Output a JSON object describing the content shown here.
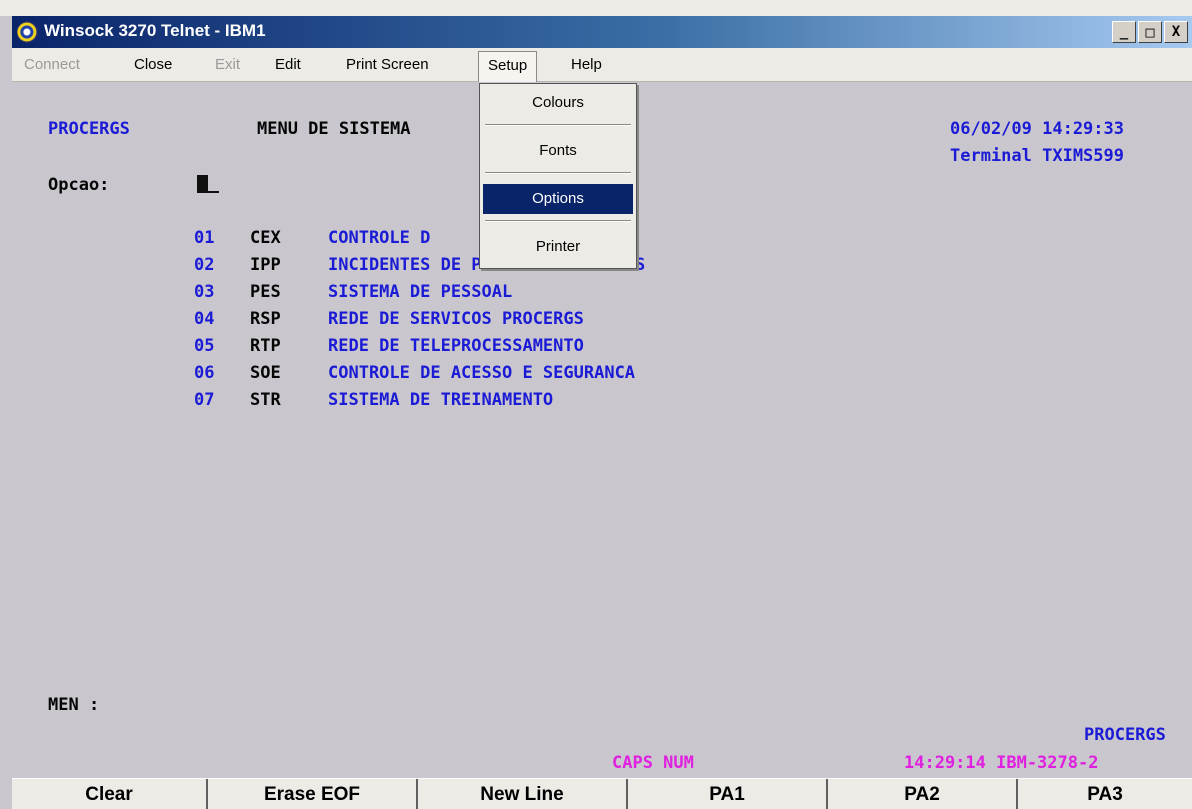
{
  "window": {
    "title": "Winsock 3270 Telnet - IBM1",
    "controls": {
      "minimize": "_",
      "maximize": "□",
      "close": "X"
    }
  },
  "menubar": {
    "items": [
      {
        "label": "Connect",
        "enabled": false
      },
      {
        "label": "Close",
        "enabled": true
      },
      {
        "label": "Exit",
        "enabled": false
      },
      {
        "label": "Edit",
        "enabled": true
      },
      {
        "label": "Print Screen",
        "enabled": true
      },
      {
        "label": "Setup",
        "enabled": true,
        "open": true
      },
      {
        "label": "Help",
        "enabled": true
      }
    ]
  },
  "setup_menu": {
    "items": [
      {
        "label": "Colours"
      },
      {
        "label": "Fonts"
      },
      {
        "label": "Options",
        "selected": true
      },
      {
        "label": "Printer"
      }
    ]
  },
  "terminal": {
    "company": "PROCERGS",
    "menu_title": "MENU DE SISTEMA",
    "datetime": "06/02/09 14:29:33",
    "terminal_id": "Terminal TXIMS599",
    "option_label": "Opcao:",
    "options": [
      {
        "num": "01",
        "code": "CEX",
        "desc": "CONTROLE D"
      },
      {
        "num": "02",
        "code": "IPP",
        "desc": "INCIDENTES DE PRODUCAO PROCERGS"
      },
      {
        "num": "03",
        "code": "PES",
        "desc": "SISTEMA DE PESSOAL"
      },
      {
        "num": "04",
        "code": "RSP",
        "desc": "REDE DE SERVICOS PROCERGS"
      },
      {
        "num": "05",
        "code": "RTP",
        "desc": "REDE DE TELEPROCESSAMENTO"
      },
      {
        "num": "06",
        "code": "SOE",
        "desc": "CONTROLE DE ACESSO E SEGURANCA"
      },
      {
        "num": "07",
        "code": "STR",
        "desc": "SISTEMA DE TREINAMENTO"
      }
    ],
    "message_label": "MEN :",
    "footer_company": "PROCERGS",
    "status_caps": "CAPS NUM",
    "status_right": "14:29:14 IBM-3278-2"
  },
  "function_keys": [
    "Clear",
    "Erase EOF",
    "New Line",
    "PA1",
    "PA2",
    "PA3"
  ],
  "colors": {
    "title_gradient_start": "#0a246a",
    "screen_bg": "#c9c7cd",
    "field_blue": "#1b1bd6",
    "status_magenta": "#e020e0",
    "menu_highlight": "#0a246a"
  }
}
